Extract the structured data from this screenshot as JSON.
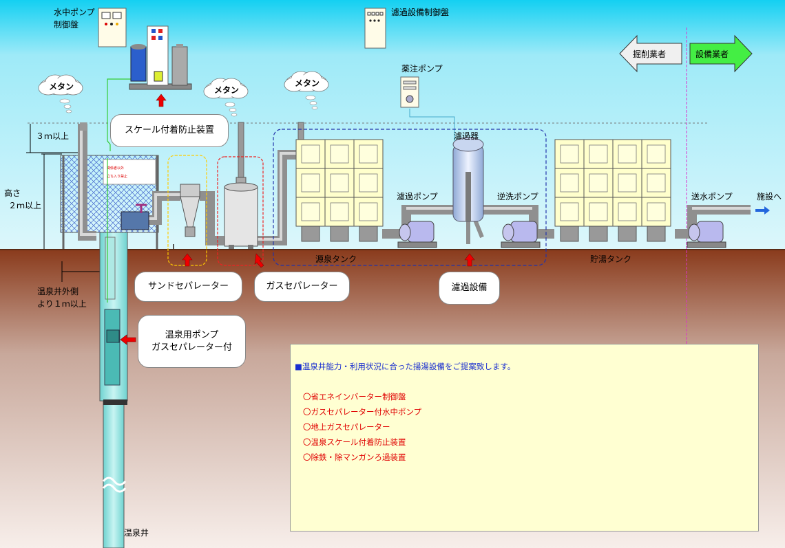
{
  "labels": {
    "submersible_panel": "水中ポンプ\n制御盤",
    "filter_panel": "濾過設備制御盤",
    "methane": "メタン",
    "scale_device": "スケール付着防止装置",
    "chemical_pump": "薬注ポンプ",
    "filter": "濾過器",
    "filter_pump": "濾過ポンプ",
    "backwash_pump": "逆洗ポンプ",
    "supply_pump": "送水ポンプ",
    "to_facility": "施設へ",
    "driller": "掘削業者",
    "equipment": "設備業者",
    "height_3m": "３ｍ以上",
    "height_label": "高さ\n２ｍ以上",
    "source_tank": "源泉タンク",
    "storage_tank": "貯湯タンク",
    "sand_separator": "サンドセパレーター",
    "gas_separator": "ガスセパレーター",
    "filter_equipment": "濾過設備",
    "well_outside": "温泉井外側\nより１ｍ以上",
    "hot_spring_pump": "温泉用ポンプ\nガスセパレーター付",
    "well": "温泉井",
    "sign_line1": "関係者以外",
    "sign_line2": "立ち入り禁止"
  },
  "note": {
    "headline": "■温泉井能力・利用状況に合った揚湯設備をご提案致します。",
    "items": [
      "〇省エネインバーター制御盤",
      "〇ガスセパレーター付水中ポンプ",
      "〇地上ガスセパレーター",
      "〇温泉スケール付着防止装置",
      "〇除鉄・除マンガンろ過装置"
    ]
  },
  "colors": {
    "sky": "#ccf5ff",
    "ground": "#7a3a22",
    "driller_arrow": "#f0f0f0",
    "equipment_arrow": "#44ee44",
    "red_arrow": "#ee0000",
    "note_bg": "#ffffd2",
    "tank_panel": "#ffffcc"
  }
}
